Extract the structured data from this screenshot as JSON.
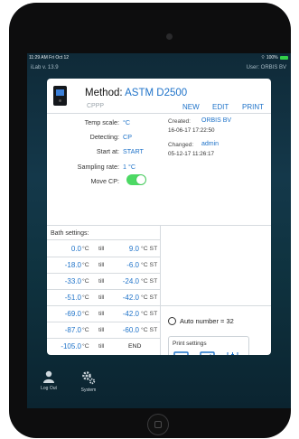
{
  "status_bar": {
    "time": "11:29 AM  Fri Oct 12",
    "battery": "100%"
  },
  "app_bar": {
    "version": "iLab v. 13.9",
    "user": "User: ORBIS BV"
  },
  "method": {
    "label": "Method:",
    "name": "ASTM D2500",
    "sub": "CPPP",
    "actions": {
      "new": "NEW",
      "edit": "EDIT",
      "print": "PRINT"
    }
  },
  "settings": {
    "temp_scale_label": "Temp scale:",
    "temp_scale": "°C",
    "detecting_label": "Detecting:",
    "detecting": "CP",
    "start_at_label": "Start at:",
    "start_at": "START",
    "sampling_rate_label": "Sampling rate:",
    "sampling_rate": "1 °C",
    "move_cp_label": "Move CP:",
    "move_cp": true
  },
  "meta": {
    "created_label": "Created:",
    "created_by": "ORBIS BV",
    "created_date": "16-06-17 17:22:50",
    "changed_label": "Changed:",
    "changed_by": "admin",
    "changed_date": "05-12-17 11:26:17"
  },
  "bath": {
    "title": "Bath settings:",
    "till": "till",
    "unit": "°C",
    "st": "ST",
    "end": "END",
    "rows": [
      {
        "from": "0.0",
        "to": "9.0"
      },
      {
        "from": "-18.0",
        "to": "-6.0"
      },
      {
        "from": "-33.0",
        "to": "-24.0"
      },
      {
        "from": "-51.0",
        "to": "-42.0"
      },
      {
        "from": "-69.0",
        "to": "-42.0"
      },
      {
        "from": "-87.0",
        "to": "-60.0"
      },
      {
        "from": "-105.0",
        "to": ""
      }
    ]
  },
  "auto_number": "Auto number = 32",
  "print_settings": {
    "title": "Print settings",
    "icons": [
      "list-icon",
      "chart-icon",
      "candlestick-icon"
    ]
  },
  "nav": {
    "logout": "Log Out",
    "system": "System"
  },
  "colors": {
    "accent": "#1f73c9",
    "toggle_on": "#4cd964",
    "background": "#14384a"
  }
}
